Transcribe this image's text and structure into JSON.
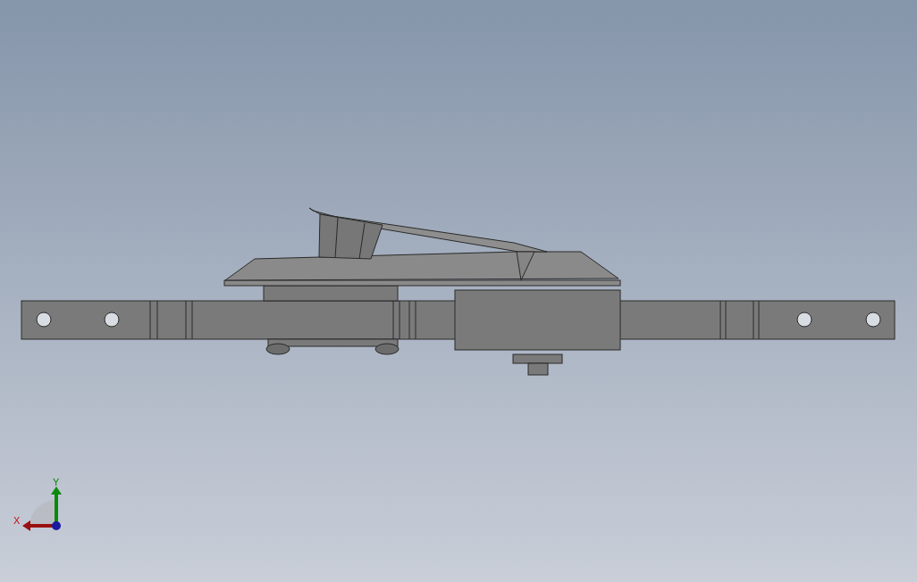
{
  "viewport": {
    "triad": {
      "x_label": "X",
      "y_label": "Y"
    }
  }
}
